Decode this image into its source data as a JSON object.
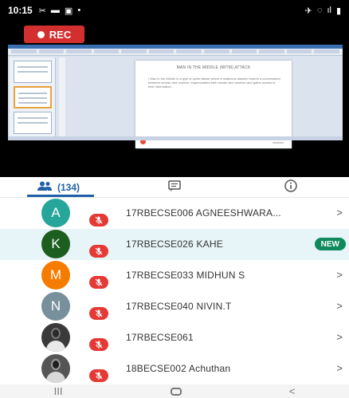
{
  "status_bar": {
    "time": "10:15",
    "left_icons": [
      "✂",
      "▬",
      "▣",
      "•"
    ],
    "right_icons": [
      "✈",
      "◌",
      "ıl",
      "▮"
    ]
  },
  "recording": {
    "label": "REC"
  },
  "presentation": {
    "slide_title": "MAN IN THE MIDDLE (MITM) ATTACK",
    "slide_body": "• Man in the Middle is a type of cyber-attack where a malicious attacker inserts a conversation between sender and receiver, impersonates both sender and receiver and gains access to their information."
  },
  "tabs": [
    {
      "label": "(134)",
      "icon": "people-icon",
      "active": true
    },
    {
      "label": "",
      "icon": "chat-icon",
      "active": false
    },
    {
      "label": "",
      "icon": "info-icon",
      "active": false
    }
  ],
  "participants": [
    {
      "initial": "A",
      "name": "17RBECSE006 AGNEESHWARA...",
      "avatar_color": "#26a69a",
      "avatar_type": "initial",
      "muted": true,
      "badge": "",
      "highlight": false
    },
    {
      "initial": "K",
      "name": "17RBECSE026 KAHE",
      "avatar_color": "#1b5e20",
      "avatar_type": "initial",
      "muted": true,
      "badge": "NEW",
      "highlight": true
    },
    {
      "initial": "M",
      "name": "17RBECSE033 MIDHUN S",
      "avatar_color": "#f57c00",
      "avatar_type": "initial",
      "muted": true,
      "badge": "",
      "highlight": false
    },
    {
      "initial": "N",
      "name": "17RBECSE040 NIVIN.T",
      "avatar_color": "#78909c",
      "avatar_type": "initial",
      "muted": true,
      "badge": "",
      "highlight": false
    },
    {
      "initial": "",
      "name": "17RBECSE061",
      "avatar_color": "#3a3a3a",
      "avatar_type": "photo",
      "muted": true,
      "badge": "",
      "highlight": false
    },
    {
      "initial": "",
      "name": "18BECSE002 Achuthan",
      "avatar_color": "#3a3a3a",
      "avatar_type": "photo",
      "muted": true,
      "badge": "",
      "highlight": false
    }
  ],
  "nav": {
    "recents": "III",
    "back": "<"
  }
}
